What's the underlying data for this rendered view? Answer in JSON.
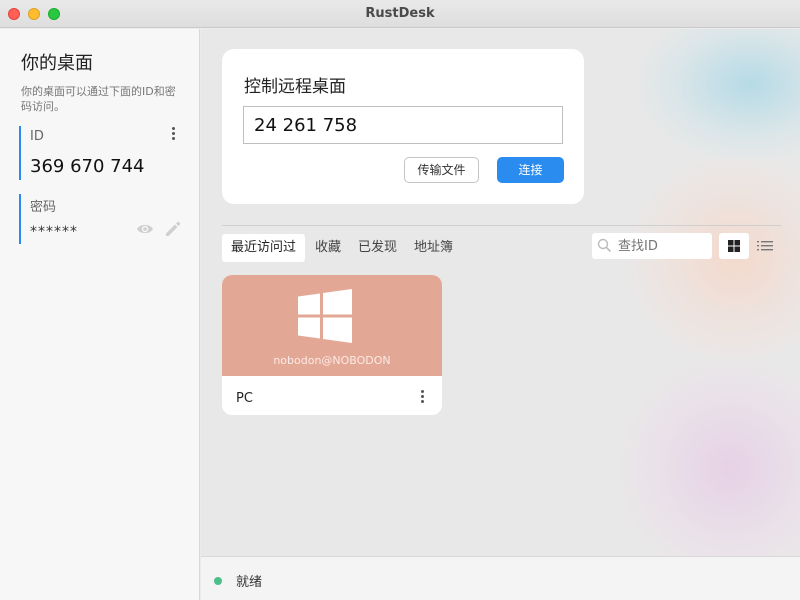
{
  "window": {
    "title": "RustDesk"
  },
  "sidebar": {
    "title": "你的桌面",
    "description": "你的桌面可以通过下面的ID和密码访问。",
    "id_label": "ID",
    "id_value": "369 670 744",
    "password_label": "密码",
    "password_value": "******"
  },
  "control": {
    "title": "控制远程桌面",
    "remote_id_value": "24 261 758",
    "transfer_label": "传输文件",
    "connect_label": "连接"
  },
  "tabs": [
    {
      "label": "最近访问过",
      "active": true
    },
    {
      "label": "收藏",
      "active": false
    },
    {
      "label": "已发现",
      "active": false
    },
    {
      "label": "地址簿",
      "active": false
    }
  ],
  "search": {
    "placeholder": "查找ID"
  },
  "peers": [
    {
      "user": "nobodon@NOBODON",
      "name": "PC",
      "os": "windows",
      "color": "#e3a795"
    }
  ],
  "status": {
    "text": "就绪",
    "color": "#4cbf8b"
  },
  "colors": {
    "accent": "#2b8cf0"
  }
}
